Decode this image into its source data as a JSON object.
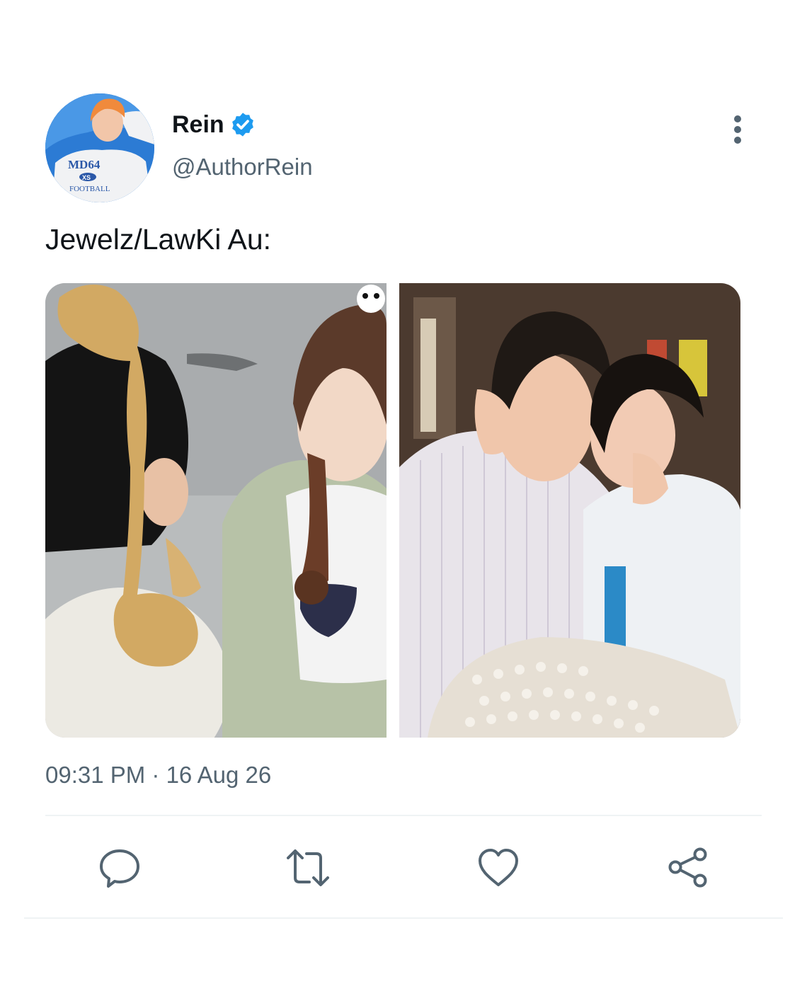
{
  "author": {
    "display_name": "Rein",
    "handle": "@AuthorRein",
    "verified": true,
    "avatar_shirt_text": "MD64",
    "avatar_badge_text": "XS",
    "avatar_sub_text": "FOOTBALL"
  },
  "tweet": {
    "text": "Jewelz/LawKi Au:",
    "timestamp": "09:31 PM · 16 Aug 26",
    "media_count": 2
  },
  "icons": {
    "more": "more-vertical-icon",
    "verified": "verified-badge-icon",
    "reply": "reply-icon",
    "retweet": "retweet-icon",
    "like": "heart-icon",
    "share": "share-icon"
  },
  "colors": {
    "verified_blue": "#1d9bf0",
    "secondary_text": "#536471",
    "primary_text": "#0f1419",
    "divider": "#eff3f4"
  }
}
